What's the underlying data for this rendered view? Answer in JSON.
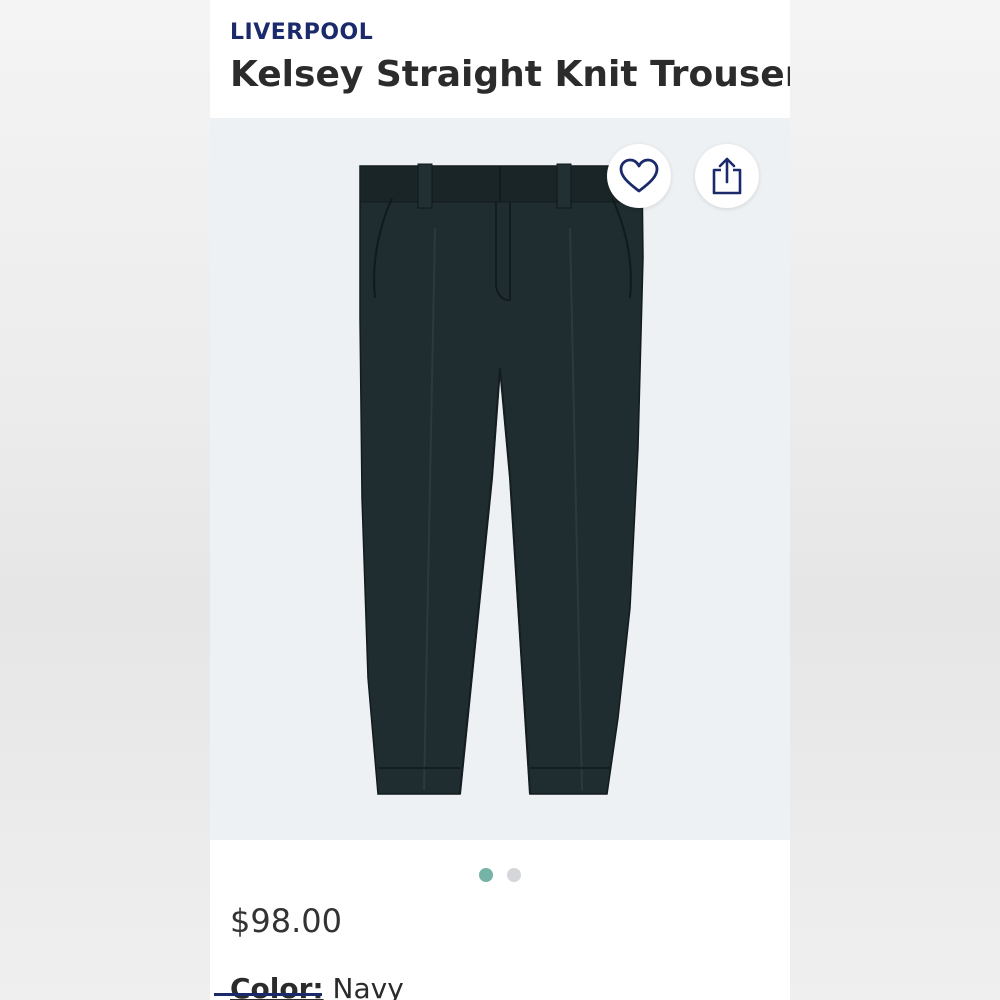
{
  "product": {
    "brand": "LIVERPOOL",
    "title": "Kelsey Straight Knit Trouser",
    "price": "$98.00",
    "color_label": "Color:",
    "color_value": "Navy"
  },
  "gallery": {
    "image": "navy-trouser-flat-lay",
    "total_images": 2,
    "active_index": 0
  },
  "icons": {
    "favorite": "heart-icon",
    "share": "share-icon"
  },
  "colors": {
    "brand": "#1b2a6b",
    "active_dot": "#74b3a6",
    "inactive_dot": "#d4d6d9",
    "image_bg": "#edf1f3",
    "pants": "#1e2a2e"
  }
}
